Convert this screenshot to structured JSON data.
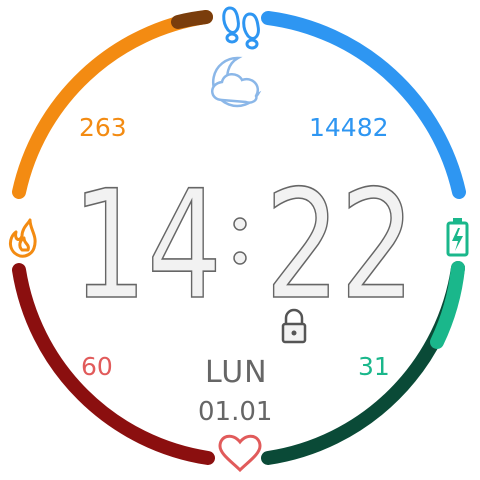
{
  "time": {
    "hours": "14",
    "minutes": "22",
    "separator": ":"
  },
  "calories": {
    "value": "263",
    "color": "#f38b12",
    "dark_color": "#7a3d0c",
    "icon": "flame-icon",
    "progress": 0.85
  },
  "steps": {
    "value": "14482",
    "color": "#2e96f2",
    "icon": "footprints-icon",
    "progress": 1.0
  },
  "heart_rate": {
    "value": "60",
    "color": "#e15b5b",
    "arc_color": "#8b0f0f",
    "icon": "heart-icon"
  },
  "battery": {
    "value": "31",
    "color": "#1ab78b",
    "dark_color": "#0a4a37",
    "icon": "battery-icon",
    "progress": 0.31
  },
  "date": {
    "weekday": "LUN",
    "day_month": "01.01"
  },
  "weather": {
    "icon": "moon-cloud-icon"
  },
  "lock": {
    "icon": "lock-icon"
  }
}
